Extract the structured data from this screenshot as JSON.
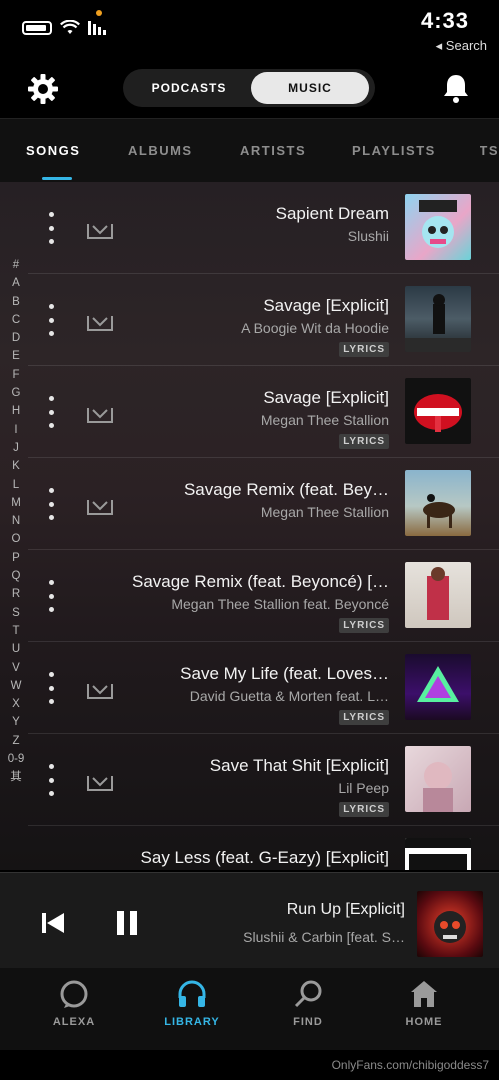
{
  "status_bar": {
    "time": "4:33",
    "back_label": "◂ Search"
  },
  "top_nav": {
    "toggle_music": "MUSIC",
    "toggle_podcasts": "PODCASTS"
  },
  "tabs": {
    "items": [
      {
        "label": "SONGS"
      },
      {
        "label": "ALBUMS"
      },
      {
        "label": "ARTISTS"
      },
      {
        "label": "PLAYLISTS"
      },
      {
        "label": "PODCASTS"
      }
    ]
  },
  "alpha_index": [
    "#",
    "A",
    "B",
    "C",
    "D",
    "E",
    "F",
    "G",
    "H",
    "I",
    "J",
    "K",
    "L",
    "M",
    "N",
    "O",
    "P",
    "Q",
    "R",
    "S",
    "T",
    "U",
    "V",
    "W",
    "X",
    "Y",
    "Z",
    "0-9",
    "其"
  ],
  "songs": [
    {
      "title": "Sapient Dream",
      "artist": "Slushii",
      "lyrics": ""
    },
    {
      "title": "Savage [Explicit]",
      "artist": "A Boogie Wit da Hoodie",
      "lyrics": "LYRICS"
    },
    {
      "title": "Savage [Explicit]",
      "artist": "Megan Thee Stallion",
      "lyrics": "LYRICS"
    },
    {
      "title": "Savage Remix (feat. Bey…",
      "artist": "Megan Thee Stallion",
      "lyrics": ""
    },
    {
      "title": "Savage Remix (feat. Beyoncé) […",
      "artist": "Megan Thee Stallion feat. Beyoncé",
      "lyrics": "LYRICS"
    },
    {
      "title": "Save My Life (feat. Loves…",
      "artist": "David Guetta & Morten feat. L…",
      "lyrics": "LYRICS"
    },
    {
      "title": "Save That Shit [Explicit]",
      "artist": "Lil Peep",
      "lyrics": "LYRICS"
    },
    {
      "title": "Say Less (feat. G-Eazy) [Explicit]",
      "artist": "",
      "lyrics": ""
    }
  ],
  "now_playing": {
    "title": "Run Up [Explicit]",
    "artist": "Slushii & Carbin [feat. S…"
  },
  "bottom_nav": {
    "alexa": "ALEXA",
    "library": "LIBRARY",
    "find": "FIND",
    "home": "HOME"
  },
  "watermark": "OnlyFans.com/chibigoddess7",
  "colors": {
    "accent": "#35b6e6",
    "background": "#000000"
  }
}
